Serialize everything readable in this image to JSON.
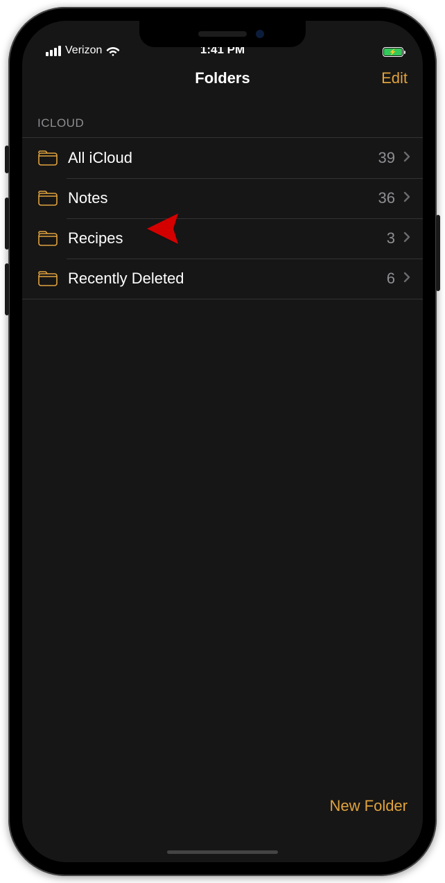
{
  "status": {
    "carrier": "Verizon",
    "time": "1:41 PM"
  },
  "nav": {
    "title": "Folders",
    "edit": "Edit"
  },
  "section": {
    "header": "ICLOUD"
  },
  "folders": [
    {
      "name": "All iCloud",
      "count": "39"
    },
    {
      "name": "Notes",
      "count": "36"
    },
    {
      "name": "Recipes",
      "count": "3"
    },
    {
      "name": "Recently Deleted",
      "count": "6"
    }
  ],
  "toolbar": {
    "new_folder": "New Folder"
  }
}
